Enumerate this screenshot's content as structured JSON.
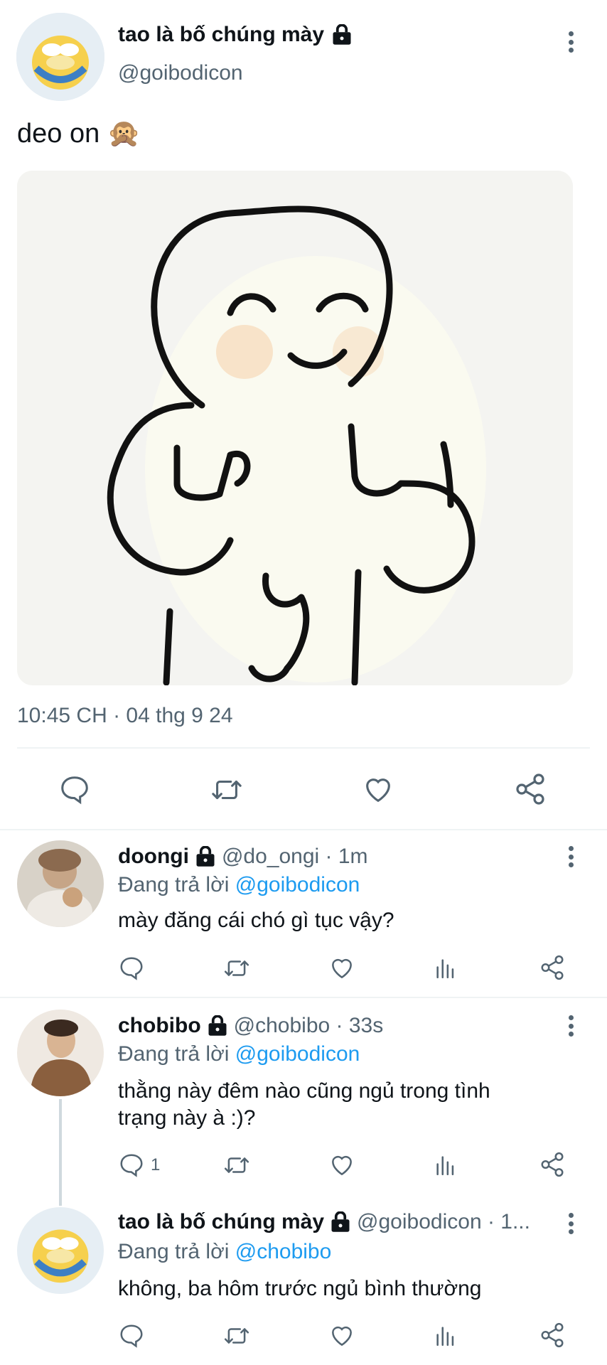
{
  "main_tweet": {
    "display_name": "tao là bố chúng mày",
    "handle": "@goibodicon",
    "text": "deo on 🙊",
    "timestamp": "10:45 CH · 04 thg 9 24"
  },
  "replies": [
    {
      "display_name": "doongi",
      "meta": "@do_ongi · 1m",
      "replying_prefix": "Đang trả lời ",
      "replying_to": "@goibodicon",
      "text": "mày đăng cái chó gì tục vậy?",
      "reply_count": ""
    },
    {
      "display_name": "chobibo",
      "meta": "@chobibo · 33s",
      "replying_prefix": "Đang trả lời ",
      "replying_to": "@goibodicon",
      "text_line1": "thằng này đêm nào cũng ngủ trong tình",
      "text_line2": "trạng này à :)?",
      "reply_count": "1"
    },
    {
      "display_name": "tao là bố chúng mày",
      "meta": "@goibodicon · 1...",
      "replying_prefix": "Đang trả lời ",
      "replying_to": "@chobibo",
      "text": "không, ba hôm trước ngủ bình thường",
      "reply_count": ""
    }
  ],
  "colors": {
    "accent": "#1d9bf0",
    "muted": "#536471",
    "text": "#0f1419"
  }
}
